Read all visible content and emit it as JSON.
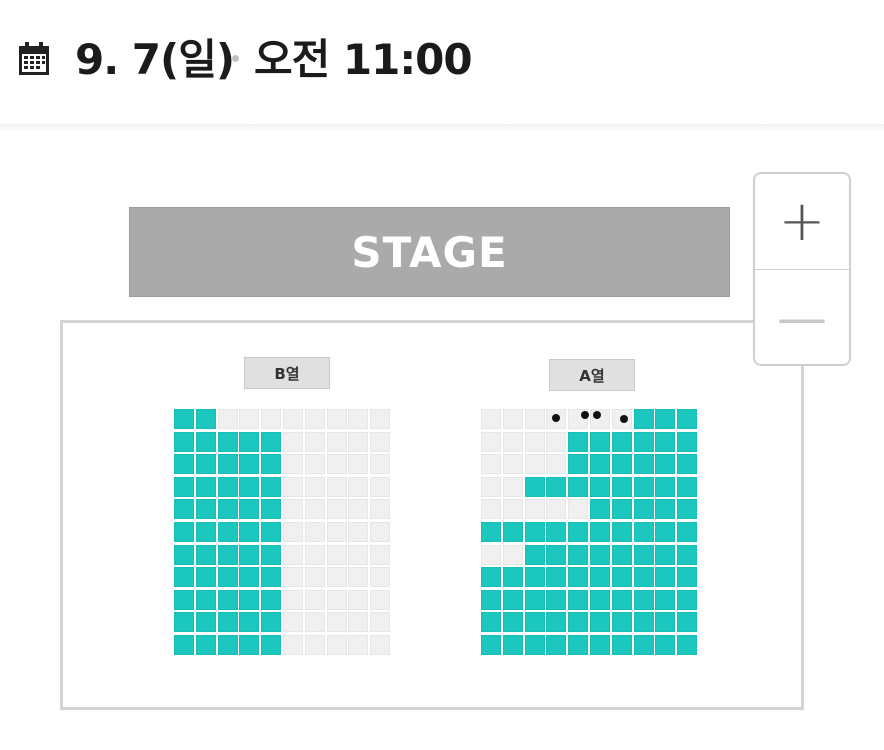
{
  "header": {
    "date": "9. 7(일)",
    "time": "오전 11:00",
    "icon": "calendar-icon"
  },
  "stage": {
    "label": "STAGE"
  },
  "blocks": [
    {
      "id": "b",
      "label": "B열",
      "rows": [
        "1100000000",
        "1111100000",
        "1111100000",
        "1111100000",
        "1111100000",
        "1111100000",
        "1111100000",
        "1111100000",
        "1111100000",
        "1111100000",
        "1111100000"
      ]
    },
    {
      "id": "a",
      "label": "A열",
      "rows": [
        "0000000111",
        "0000111111",
        "0000111111",
        "0011111111",
        "0000011111",
        "1111111111",
        "0011111111",
        "1111111111",
        "1111111111",
        "1111111111",
        "1111111111"
      ]
    }
  ],
  "zoom": {
    "in_label": "+",
    "out_label": "—",
    "in_icon": "plus-icon",
    "out_icon": "minus-icon"
  },
  "colors": {
    "available": "#1cc7c0",
    "unavailable": "#f0f0f0",
    "stage": "#aaaaaa"
  }
}
